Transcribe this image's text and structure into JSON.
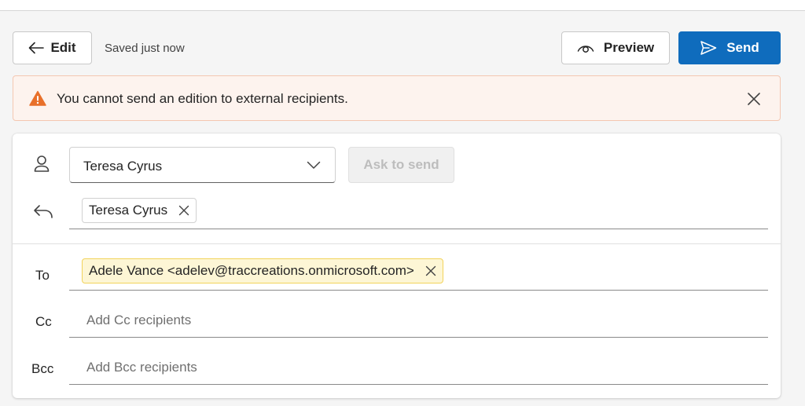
{
  "header": {
    "edit_label": "Edit",
    "saved_status": "Saved just now",
    "preview_label": "Preview",
    "send_label": "Send"
  },
  "warning": {
    "message": "You cannot send an edition to external recipients."
  },
  "compose": {
    "from_selected": "Teresa Cyrus",
    "ask_to_send_label": "Ask to send",
    "reply_to_chip": "Teresa Cyrus",
    "to_label": "To",
    "to_chip": "Adele Vance <adelev@traccreations.onmicrosoft.com>",
    "cc_label": "Cc",
    "cc_placeholder": "Add Cc recipients",
    "bcc_label": "Bcc",
    "bcc_placeholder": "Add Bcc recipients"
  },
  "icons": {
    "edit": "arrow-left-icon",
    "preview": "eye-icon",
    "send": "send-icon",
    "warning": "warning-icon",
    "dismiss": "close-icon",
    "from": "person-icon",
    "reply": "reply-icon",
    "dropdown": "chevron-down-icon"
  },
  "colors": {
    "accent": "#0f6cbd",
    "warning_bg": "#fdf3ee",
    "warning_icon": "#e8702a",
    "external_chip_bg": "#fdf6d5"
  }
}
